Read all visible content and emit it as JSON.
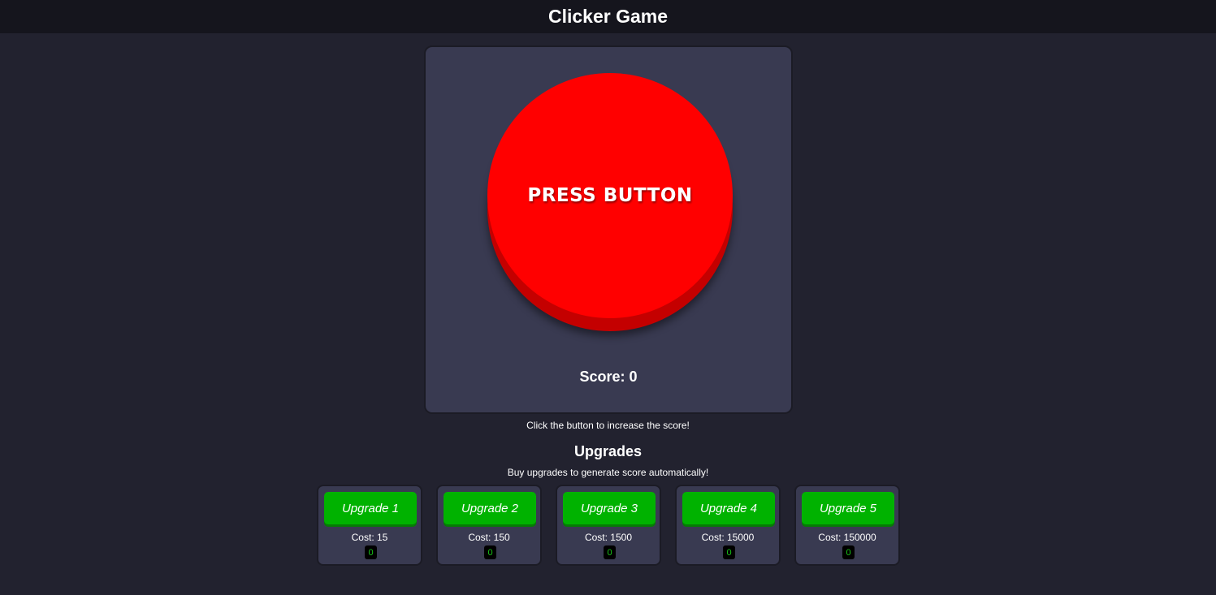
{
  "header": {
    "title": "Clicker Game"
  },
  "game": {
    "button_label": "PRESS BUTTON",
    "score_text": "Score: 0",
    "button_color": "#ff0000"
  },
  "hint": "Click the button to increase the score!",
  "upgrades": {
    "title": "Upgrades",
    "subtitle": "Buy upgrades to generate score automatically!",
    "items": [
      {
        "label": "Upgrade 1",
        "cost": "Cost: 15",
        "count": "0"
      },
      {
        "label": "Upgrade 2",
        "cost": "Cost: 150",
        "count": "0"
      },
      {
        "label": "Upgrade 3",
        "cost": "Cost: 1500",
        "count": "0"
      },
      {
        "label": "Upgrade 4",
        "cost": "Cost: 15000",
        "count": "0"
      },
      {
        "label": "Upgrade 5",
        "cost": "Cost: 150000",
        "count": "0"
      }
    ],
    "button_color": "#00b200"
  }
}
